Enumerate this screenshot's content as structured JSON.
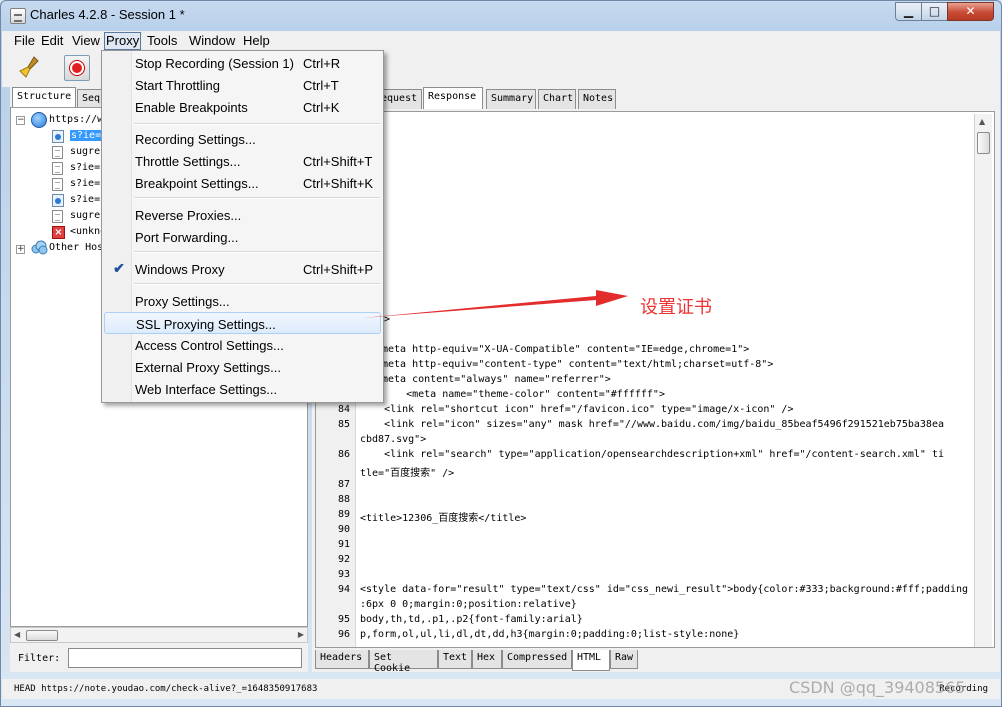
{
  "window": {
    "title": "Charles 4.2.8 - Session 1 *",
    "minimize_glyph": "▁",
    "maximize_glyph": "□",
    "close_glyph": "✕"
  },
  "menubar": {
    "items": [
      "File",
      "Edit",
      "View",
      "Proxy",
      "Tools",
      "Window",
      "Help"
    ],
    "active": "Proxy"
  },
  "proxy_menu": {
    "items": [
      {
        "label": "Stop Recording (Session 1)",
        "shortcut": "Ctrl+R"
      },
      {
        "label": "Start Throttling",
        "shortcut": "Ctrl+T"
      },
      {
        "label": "Enable Breakpoints",
        "shortcut": "Ctrl+K"
      },
      {
        "label": "Recording Settings...",
        "shortcut": ""
      },
      {
        "label": "Throttle Settings...",
        "shortcut": "Ctrl+Shift+T"
      },
      {
        "label": "Breakpoint Settings...",
        "shortcut": "Ctrl+Shift+K"
      },
      {
        "label": "Reverse Proxies...",
        "shortcut": ""
      },
      {
        "label": "Port Forwarding...",
        "shortcut": ""
      },
      {
        "label": "Windows Proxy",
        "shortcut": "Ctrl+Shift+P",
        "checked": true
      },
      {
        "label": "Proxy Settings...",
        "shortcut": ""
      },
      {
        "label": "SSL Proxying Settings...",
        "shortcut": "",
        "highlighted": true
      },
      {
        "label": "Access Control Settings...",
        "shortcut": ""
      },
      {
        "label": "External Proxy Settings...",
        "shortcut": ""
      },
      {
        "label": "Web Interface Settings...",
        "shortcut": ""
      }
    ],
    "check_glyph": "✔"
  },
  "left_panel": {
    "tabs": [
      "Structure",
      "Seq"
    ],
    "tree": [
      {
        "label": "https://w",
        "icon": "globe-icon"
      },
      {
        "label": "s?ie=u",
        "icon": "blue-doc-icon",
        "selected": true
      },
      {
        "label": "sugres",
        "icon": "doc-icon"
      },
      {
        "label": "s?ie=u",
        "icon": "doc-icon"
      },
      {
        "label": "s?ie=u",
        "icon": "doc-icon"
      },
      {
        "label": "s?ie=u",
        "icon": "blue-doc-icon"
      },
      {
        "label": "sugres",
        "icon": "doc-icon"
      },
      {
        "label": "<unkno",
        "icon": "error-icon"
      },
      {
        "label": "Other Hos",
        "icon": "cloud-icon"
      }
    ],
    "filter_label": "Filter:",
    "filter_value": ""
  },
  "right_panel": {
    "tabs": [
      "equest",
      "Response",
      "Summary",
      "Chart",
      "Notes"
    ],
    "active_tab": "Response",
    "bottom_tabs": [
      "Headers",
      "Set Cookie",
      "Text",
      "Hex",
      "Compressed",
      "HTML",
      "Raw"
    ],
    "active_bottom_tab": "HTML",
    "code_lines": [
      {
        "no": "",
        "text": ">"
      },
      {
        "no": "",
        "text": "ead>"
      },
      {
        "no": "",
        "text": "meta http-equiv=\"X-UA-Compatible\" content=\"IE=edge,chrome=1\">"
      },
      {
        "no": "",
        "text": "meta http-equiv=\"content-type\" content=\"text/html;charset=utf-8\">"
      },
      {
        "no": "",
        "text": "meta content=\"always\" name=\"referrer\">"
      },
      {
        "no": "",
        "text": "    <meta name=\"theme-color\" content=\"#ffffff\">"
      },
      {
        "no": "84",
        "text": "    <link rel=\"shortcut icon\" href=\"/favicon.ico\" type=\"image/x-icon\" />"
      },
      {
        "no": "85",
        "text": "    <link rel=\"icon\" sizes=\"any\" mask href=\"//www.baidu.com/img/baidu_85beaf5496f291521eb75ba38ea"
      },
      {
        "no": "",
        "text": "cbd87.svg\">"
      },
      {
        "no": "86",
        "text": "    <link rel=\"search\" type=\"application/opensearchdescription+xml\" href=\"/content-search.xml\" ti"
      },
      {
        "no": "",
        "text": "tle=\"百度搜索\" />"
      },
      {
        "no": "87",
        "text": ""
      },
      {
        "no": "88",
        "text": ""
      },
      {
        "no": "89",
        "text": "<title>12306_百度搜索</title>"
      },
      {
        "no": "90",
        "text": ""
      },
      {
        "no": "91",
        "text": ""
      },
      {
        "no": "92",
        "text": ""
      },
      {
        "no": "93",
        "text": ""
      },
      {
        "no": "94",
        "text": "<style data-for=\"result\" type=\"text/css\" id=\"css_newi_result\">body{color:#333;background:#fff;padding"
      },
      {
        "no": "",
        "text": ":6px 0 0;margin:0;position:relative}"
      },
      {
        "no": "95",
        "text": "body,th,td,.p1,.p2{font-family:arial}"
      },
      {
        "no": "96",
        "text": "p,form,ol,ul,li,dl,dt,dd,h3{margin:0;padding:0;list-style:none}"
      }
    ]
  },
  "statusbar": {
    "text": "HEAD https://note.youdao.com/check-alive?_=1648350917683",
    "right": "Recording"
  },
  "annotation": {
    "text": "设置证书",
    "color": "#e33"
  },
  "watermark": {
    "text": "CSDN @qq_39408565"
  }
}
